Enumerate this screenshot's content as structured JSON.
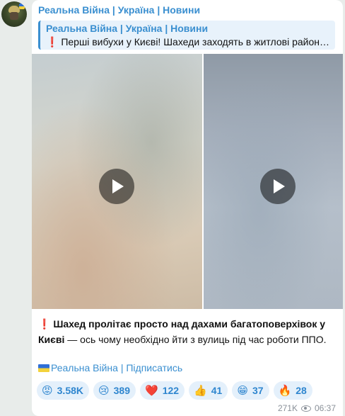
{
  "message": {
    "channel_name": "Реальна Війна | Україна | Новини",
    "reply": {
      "title": "Реальна Війна | Україна | Новини",
      "text": "Перші вибухи у Києві! Шахеди заходять в житлові район…"
    },
    "caption": {
      "excl": "❗️",
      "bold_part": "Шахед пролітає просто над дахами багатоповерхівок у Києві",
      "rest": " — ось чому необхідно йти з вулиць під час роботи ППО."
    },
    "subscribe_link": "Реальна Війна | Підписатись",
    "reactions": [
      {
        "emoji": "😡",
        "count": "3.58K"
      },
      {
        "emoji": "😢",
        "count": "389"
      },
      {
        "emoji": "❤️",
        "count": "122"
      },
      {
        "emoji": "👍",
        "count": "41"
      },
      {
        "emoji": "😁",
        "count": "37"
      },
      {
        "emoji": "🔥",
        "count": "28"
      }
    ],
    "views": "271K",
    "time": "06:37"
  },
  "colors": {
    "accent": "#3a8fd0",
    "reply_bg": "#e8f2fb",
    "reaction_bg": "#e4f0fb",
    "alert": "#d2252a",
    "chat_bg": "#e8ecea"
  },
  "icons": {
    "play": "play-icon",
    "views": "eye-icon"
  }
}
